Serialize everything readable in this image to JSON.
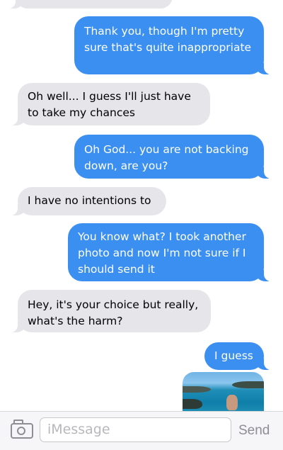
{
  "messages": [
    {
      "id": "m0",
      "direction": "incoming",
      "text": ""
    },
    {
      "id": "m1",
      "direction": "outgoing",
      "text": "Thank you, though I'm pretty\nsure that's quite inappropriate"
    },
    {
      "id": "m2",
      "direction": "incoming",
      "text": "Oh well... I guess I'll just have\nto take my chances"
    },
    {
      "id": "m3",
      "direction": "outgoing",
      "text": "Oh God... you are not backing\ndown, are you?"
    },
    {
      "id": "m4",
      "direction": "incoming",
      "text": "I have no intentions to"
    },
    {
      "id": "m5",
      "direction": "outgoing",
      "text": "You know what? I took another\nphoto and now I'm not sure if I\nshould send it"
    },
    {
      "id": "m6",
      "direction": "incoming",
      "text": "Hey, it's your choice but really,\nwhat's the harm?"
    },
    {
      "id": "m7",
      "direction": "outgoing",
      "text": "I guess"
    }
  ],
  "attachment": {
    "type": "photo",
    "direction": "outgoing"
  },
  "composer": {
    "placeholder": "iMessage",
    "send_label": "Send",
    "camera_icon": "camera-icon"
  },
  "colors": {
    "outgoing_bubble": "#3a8ff0",
    "incoming_bubble": "#e5e5ea",
    "toolbar": "#f6f6f8"
  }
}
